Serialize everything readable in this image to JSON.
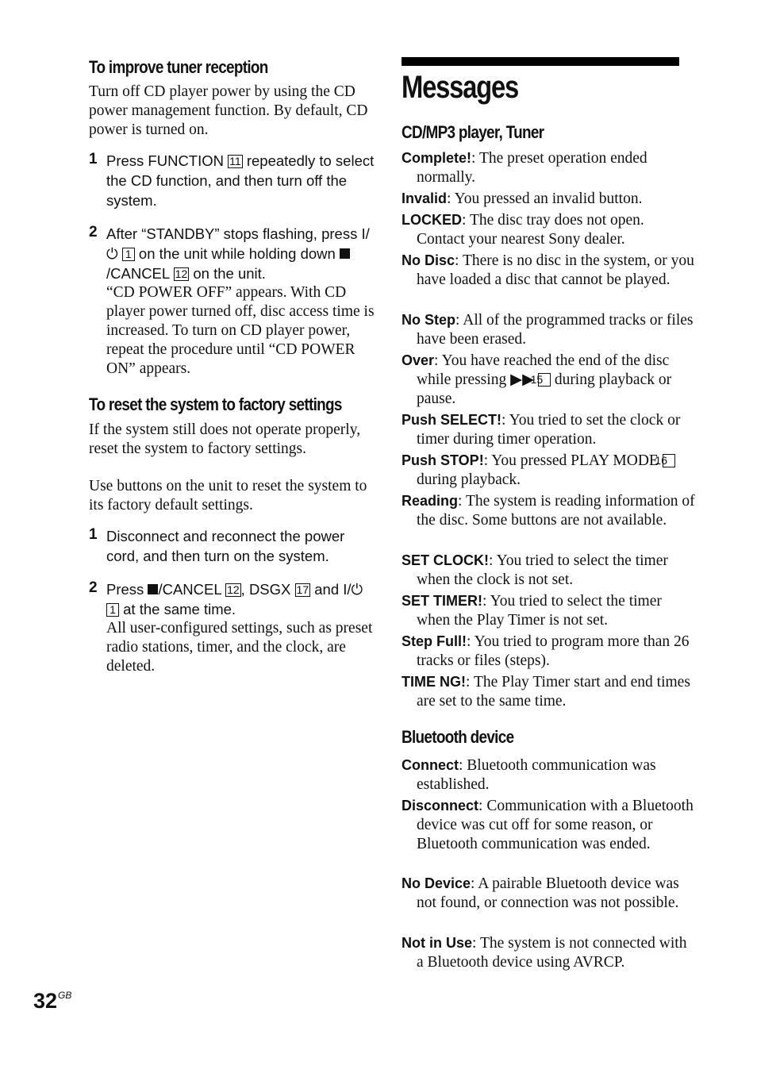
{
  "left": {
    "section1": {
      "heading": "To improve tuner reception",
      "intro": "Turn off CD player power by using the CD power management function. By default, CD power is turned on.",
      "steps": [
        {
          "num": "1",
          "pre": "Press FUNCTION ",
          "key": "11",
          "post": " repeatedly to select the CD function, and then turn off the system."
        },
        {
          "num": "2",
          "pre": "After “STANDBY” stops flashing, press I/⏻ ",
          "key1": "1",
          "mid": " on the unit while holding down ",
          "mid2": "/CANCEL ",
          "key2": "12",
          "post": " on the unit.",
          "note": "“CD POWER OFF” appears. With CD player power turned off, disc access time is increased. To turn on CD player power, repeat the procedure until “CD POWER ON” appears."
        }
      ]
    },
    "section2": {
      "heading": "To reset the system to factory settings",
      "intro1": "If the system still does not operate properly, reset the system to factory settings.",
      "intro2": "Use buttons on the unit to reset the system to its factory default settings.",
      "steps": [
        {
          "num": "1",
          "text": "Disconnect and reconnect the power cord, and then turn on the system."
        },
        {
          "num": "2",
          "pre": "Press ",
          "cancel": "/CANCEL ",
          "key1": "12",
          "mid": ", DSGX ",
          "key2": "17",
          "mid2": " and I/⏻ ",
          "key3": "1",
          "post": " at the same time.",
          "note": "All user-configured settings, such as preset radio stations, timer, and the clock, are deleted."
        }
      ]
    }
  },
  "right": {
    "title": "Messages",
    "cd_heading": "CD/MP3 player, Tuner",
    "cd_messages": [
      {
        "term": "Complete!",
        "desc": ": The preset operation ended normally."
      },
      {
        "term": "Invalid",
        "desc": ": You pressed an invalid button."
      },
      {
        "term": "LOCKED",
        "desc": ": The disc tray does not open. Contact your nearest Sony dealer."
      },
      {
        "term": "No Disc",
        "desc": ": There is no disc in the system, or you have loaded a disc that cannot be played."
      },
      {
        "term": "No Step",
        "desc": ": All of the programmed tracks or files have been erased."
      },
      {
        "term": "Over",
        "desc": ": You have reached the end of the disc while pressing ▶▶ ",
        "key": "15",
        "desc2": " during playback or pause."
      },
      {
        "term": "Push SELECT!",
        "desc": ": You tried to set the clock or timer during timer operation."
      },
      {
        "term": "Push STOP!",
        "desc": ": You pressed PLAY MODE ",
        "key": "16",
        "desc2": " during playback."
      },
      {
        "term": "Reading",
        "desc": ": The system is reading information of the disc. Some buttons are not available."
      },
      {
        "term": "SET CLOCK!",
        "desc": ": You tried to select the timer when the clock is not set."
      },
      {
        "term": "SET TIMER!",
        "desc": ": You tried to select the timer when the Play Timer is not set."
      },
      {
        "term": "Step Full!",
        "desc": ": You tried to program more than 26 tracks or files (steps)."
      },
      {
        "term": "TIME NG!",
        "desc": ": The Play Timer start and end times are set to the same time."
      }
    ],
    "bt_heading": "Bluetooth device",
    "bt_messages": [
      {
        "term": "Connect",
        "desc": ": Bluetooth communication was established."
      },
      {
        "term": "Disconnect",
        "desc": ": Communication with a Bluetooth device was cut off for some reason, or Bluetooth communication was ended."
      },
      {
        "term": "No Device",
        "desc": ": A pairable Bluetooth device was not found, or connection was not possible."
      },
      {
        "term": "Not in Use",
        "desc": ": The system is not connected with a Bluetooth device using AVRCP."
      }
    ]
  },
  "footer": {
    "page_number": "32",
    "page_suffix": "GB"
  }
}
